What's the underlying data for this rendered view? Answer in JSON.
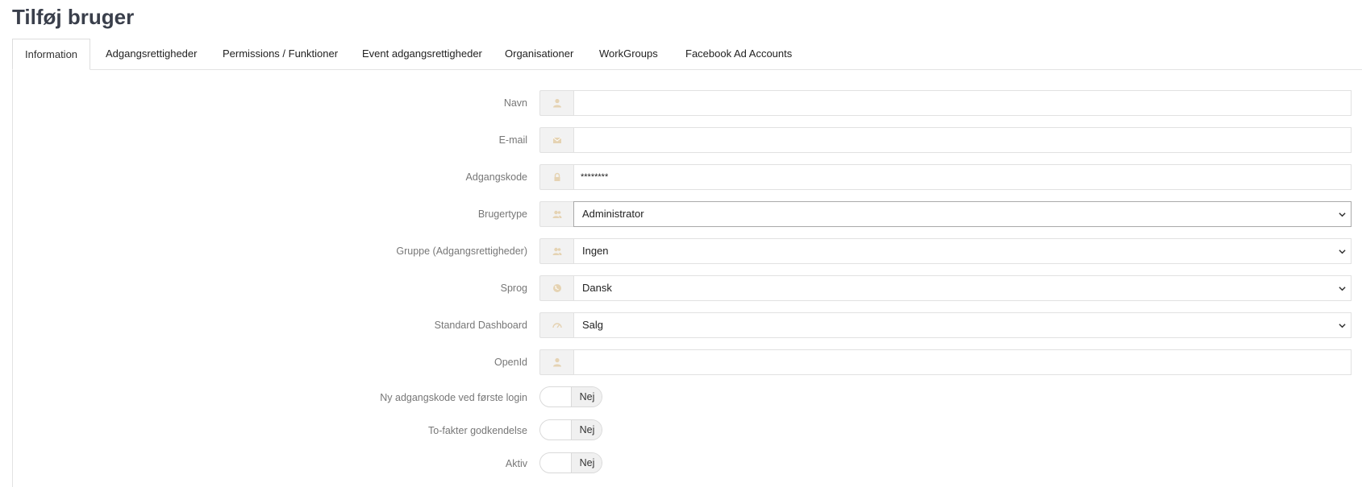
{
  "page": {
    "title": "Tilføj bruger"
  },
  "tabs": [
    {
      "label": "Information",
      "active": true
    },
    {
      "label": "Adgangsrettigheder",
      "active": false
    },
    {
      "label": "Permissions / Funktioner",
      "active": false
    },
    {
      "label": "Event adgangsrettigheder",
      "active": false
    },
    {
      "label": "Organisationer",
      "active": false
    },
    {
      "label": "WorkGroups",
      "active": false
    },
    {
      "label": "Facebook Ad Accounts",
      "active": false
    }
  ],
  "form": {
    "name": {
      "label": "Navn",
      "value": "",
      "icon": "user-icon"
    },
    "email": {
      "label": "E-mail",
      "value": "",
      "icon": "envelope-icon"
    },
    "password": {
      "label": "Adgangskode",
      "value": "********",
      "icon": "lock-icon"
    },
    "user_type": {
      "label": "Brugertype",
      "selected": "Administrator",
      "icon": "users-icon"
    },
    "group": {
      "label": "Gruppe (Adgangsrettigheder)",
      "selected": "Ingen",
      "icon": "users-icon"
    },
    "language": {
      "label": "Sprog",
      "selected": "Dansk",
      "icon": "globe-icon"
    },
    "dashboard": {
      "label": "Standard Dashboard",
      "selected": "Salg",
      "icon": "gauge-icon"
    },
    "openid": {
      "label": "OpenId",
      "value": "",
      "icon": "user-icon"
    },
    "new_password_first_login": {
      "label": "Ny adgangskode ved første login",
      "state": "Nej"
    },
    "two_factor": {
      "label": "To-fakter godkendelse",
      "state": "Nej"
    },
    "active": {
      "label": "Aktiv",
      "state": "Nej"
    }
  },
  "colors": {
    "icon": "#e5d3b3",
    "addon_bg": "#f2f2f2",
    "border": "#e1e1e1",
    "label": "#777777"
  }
}
